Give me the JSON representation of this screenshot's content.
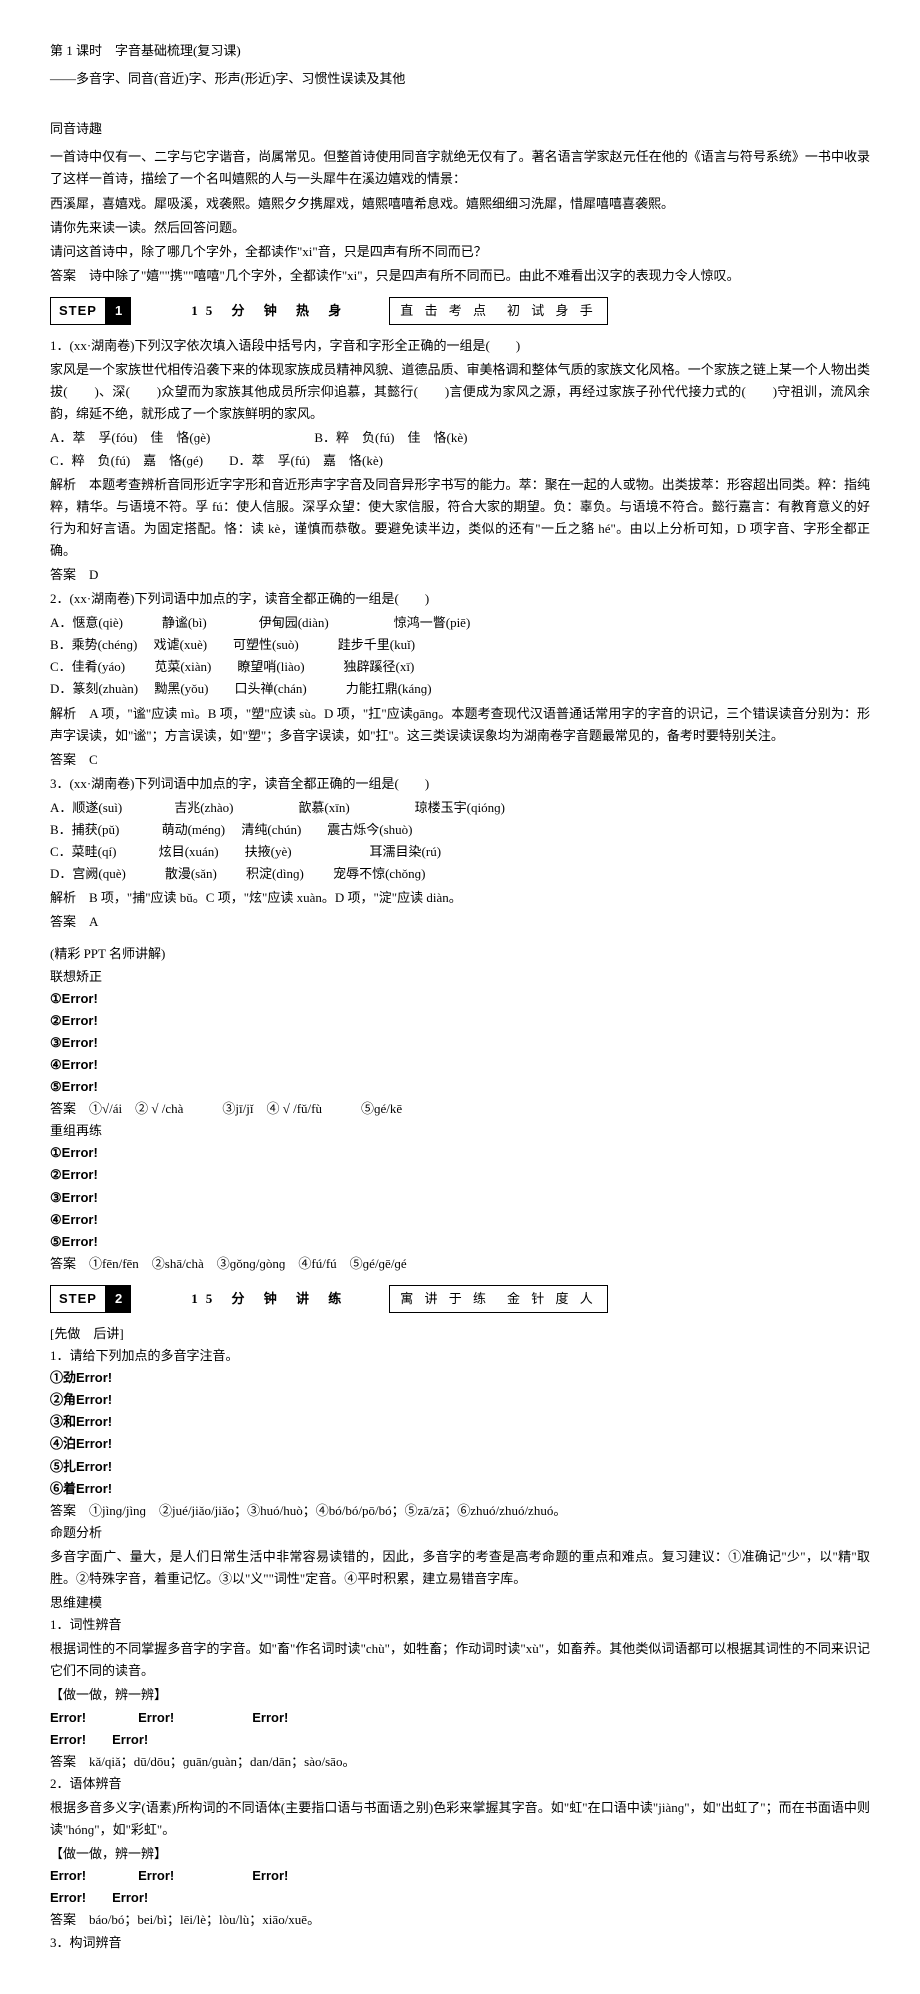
{
  "header": {
    "lesson": "第 1 课时　字音基础梳理(复习课)",
    "subtitle": "——多音字、同音(音近)字、形声(形近)字、习惯性误读及其他"
  },
  "poem": {
    "title": "同音诗趣",
    "p1": "一首诗中仅有一、二字与它字谐音，尚属常见。但整首诗使用同音字就绝无仅有了。著名语言学家赵元任在他的《语言与符号系统》一书中收录了这样一首诗，描绘了一个名叫嬉熙的人与一头犀牛在溪边嬉戏的情景：",
    "p2": "西溪犀，喜嬉戏。犀吸溪，戏袭熙。嬉熙夕夕携犀戏，嬉熙嘻嘻希息戏。嬉熙细细习洗犀，惜犀嘻嘻喜袭熙。",
    "p3": "请你先来读一读。然后回答问题。",
    "p4": "请问这首诗中，除了哪几个字外，全都读作\"xi\"音，只是四声有所不同而已？",
    "p5": "答案　诗中除了\"嬉\"\"携\"\"嘻嘻\"几个字外，全都读作\"xi\"，只是四声有所不同而已。由此不难看出汉字的表现力令人惊叹。"
  },
  "step1": {
    "label": "STEP",
    "num": "1",
    "title": "15 分 钟 热 身",
    "sub": "直 击 考 点　初 试 身 手"
  },
  "q1": {
    "stem": "1．(xx·湖南卷)下列汉字依次填入语段中括号内，字音和字形全正确的一组是(　　)",
    "body": "家风是一个家族世代相传沿袭下来的体现家族成员精神风貌、道德品质、审美格调和整体气质的家族文化风格。一个家族之链上某一个人物出类拔(　　)、深(　　)众望而为家族其他成员所宗仰追慕，其懿行(　　)言便成为家风之源，再经过家族子孙代代接力式的(　　)守祖训，流风余韵，绵延不绝，就形成了一个家族鲜明的家风。",
    "optA": "A．萃　孚(fóu)　佳　恪(ɡè)",
    "optB": "B．粹　负(fú)　佳　恪(kè)",
    "optC": "C．粹　负(fú)　嘉　恪(ɡé)",
    "optD": "D．萃　孚(fú)　嘉　恪(kè)",
    "expl": "解析　本题考查辨析音同形近字字形和音近形声字字音及同音异形字书写的能力。萃：聚在一起的人或物。出类拔萃：形容超出同类。粹：指纯粹，精华。与语境不符。孚 fú：使人信服。深孚众望：使大家信服，符合大家的期望。负：辜负。与语境不符合。懿行嘉言：有教育意义的好行为和好言语。为固定搭配。恪：读 kè，谨慎而恭敬。要避免读半边，类似的还有\"一丘之貉 hé\"。由以上分析可知，D 项字音、字形全都正确。",
    "ans": "答案　D"
  },
  "q2": {
    "stem": "2．(xx·湖南卷)下列词语中加点的字，读音全都正确的一组是(　　)",
    "optA": "A．惬意(qiè)　　　静谧(bì)　　　　伊甸园(diàn)　　　　　惊鸿一瞥(piē)",
    "optB": "B．乘势(chénɡ)　 戏谑(xuè)　　可塑性(suò)　　　跬步千里(kuǐ)",
    "optC": "C．佳肴(yáo)　　 苋菜(xiàn)　　瞭望哨(liào)　　　独辟蹊径(xī)",
    "optD": "D．篆刻(zhuàn)　 黝黑(yǒu)　　口头禅(chán)　　　力能扛鼎(kánɡ)",
    "expl": "解析　A 项，\"谧\"应读 mì。B 项，\"塑\"应读 sù。D 项，\"扛\"应读ɡānɡ。本题考查现代汉语普通话常用字的字音的识记，三个错误读音分别为：形声字误读，如\"谧\"；方言误读，如\"塑\"；多音字误读，如\"扛\"。这三类误读误象均为湖南卷字音题最常见的，备考时要特别关注。",
    "ans": "答案　C"
  },
  "q3": {
    "stem": "3．(xx·湖南卷)下列词语中加点的字，读音全都正确的一组是(　　)",
    "optA": "A．顺遂(suì)　　　　吉兆(zhào)　　　　　歆慕(xīn)　　　　　琼楼玉宇(qiónɡ)",
    "optB": "B．捕获(pǔ)　　　 萌动(ménɡ)　 清纯(chún)　　震古烁今(shuò)",
    "optC": "C．菜畦(qí)　　　 炫目(xuán)　　扶掖(yè)　　　　　　耳濡目染(rú)",
    "optD": "D．宫阙(què)　　　散漫(sǎn)　　 积淀(dìnɡ)　　 宠辱不惊(chǒnɡ)",
    "expl": "解析　B 项，\"捕\"应读 bǔ。C 项，\"炫\"应读 xuàn。D 项，\"淀\"应读 diàn。",
    "ans": "答案　A"
  },
  "ppt": {
    "head": "(精彩 PPT 名师讲解)",
    "lx_title": "联想矫正",
    "e1": "①Error!",
    "e2": "②Error!",
    "e3": "③Error!",
    "e4": "④Error!",
    "e5": "⑤Error!",
    "lx_ans": "答案　①√/ái　② √ /chà　　　③jī/jǐ　④ √ /fǔ/fù　　　⑤ɡé/kē",
    "cz_title": "重组再练",
    "cz_ans": "答案　①fēn/fēn　②shā/chà　③ɡǒnɡ/ɡònɡ　④fú/fú　⑤ɡé/ɡē/ɡé"
  },
  "step2": {
    "label": "STEP",
    "num": "2",
    "title": "15 分 钟 讲 练",
    "sub": "寓 讲 于 练　金 针 度 人"
  },
  "part2": {
    "head": "[先做　后讲]",
    "q": "1．请给下列加点的多音字注音。",
    "i1": "①劲Error!",
    "i2": "②角Error!",
    "i3": "③和Error!",
    "i4": "④泊Error!",
    "i5": "⑤扎Error!",
    "i6": "⑥着Error!",
    "ans": "答案　①jìnɡ/jìnɡ　②jué/jiǎo/jiǎo；③huó/huò；④bó/bó/pō/bó；⑤zā/zā；⑥zhuó/zhuó/zhuó。",
    "mt_title": "命题分析",
    "mt_body": "多音字面广、量大，是人们日常生活中非常容易读错的，因此，多音字的考查是高考命题的重点和难点。复习建议：①准确记\"少\"，以\"精\"取胜。②特殊字音，着重记忆。③以\"义\"\"词性\"定音。④平时积累，建立易错音字库。",
    "sw_title": "思维建模",
    "m1_title": "1．词性辨音",
    "m1_body": "根据词性的不同掌握多音字的字音。如\"畜\"作名词时读\"chù\"，如牲畜；作动词时读\"xù\"，如畜养。其他类似词语都可以根据其词性的不同来识记它们不同的读音。",
    "do_label": "【做一做，辨一辨】",
    "err_row1": "Error!　　　　Error!　　　　　　Error!",
    "err_row2": "Error!　　Error!",
    "m1_ans": "答案　kǎ/qiǎ；dū/dōu；ɡuān/ɡuàn；dan/dān；sào/sāo。",
    "m2_title": "2．语体辨音",
    "m2_body": "根据多音多义字(语素)所构词的不同语体(主要指口语与书面语之别)色彩来掌握其字音。如\"虹\"在口语中读\"jiànɡ\"，如\"出虹了\"；而在书面语中则读\"hónɡ\"，如\"彩虹\"。",
    "m2_ans": "答案　báo/bó；bei/bì；lēi/lè；lòu/lù；xiāo/xuē。",
    "m3_title": "3．构词辨音"
  }
}
